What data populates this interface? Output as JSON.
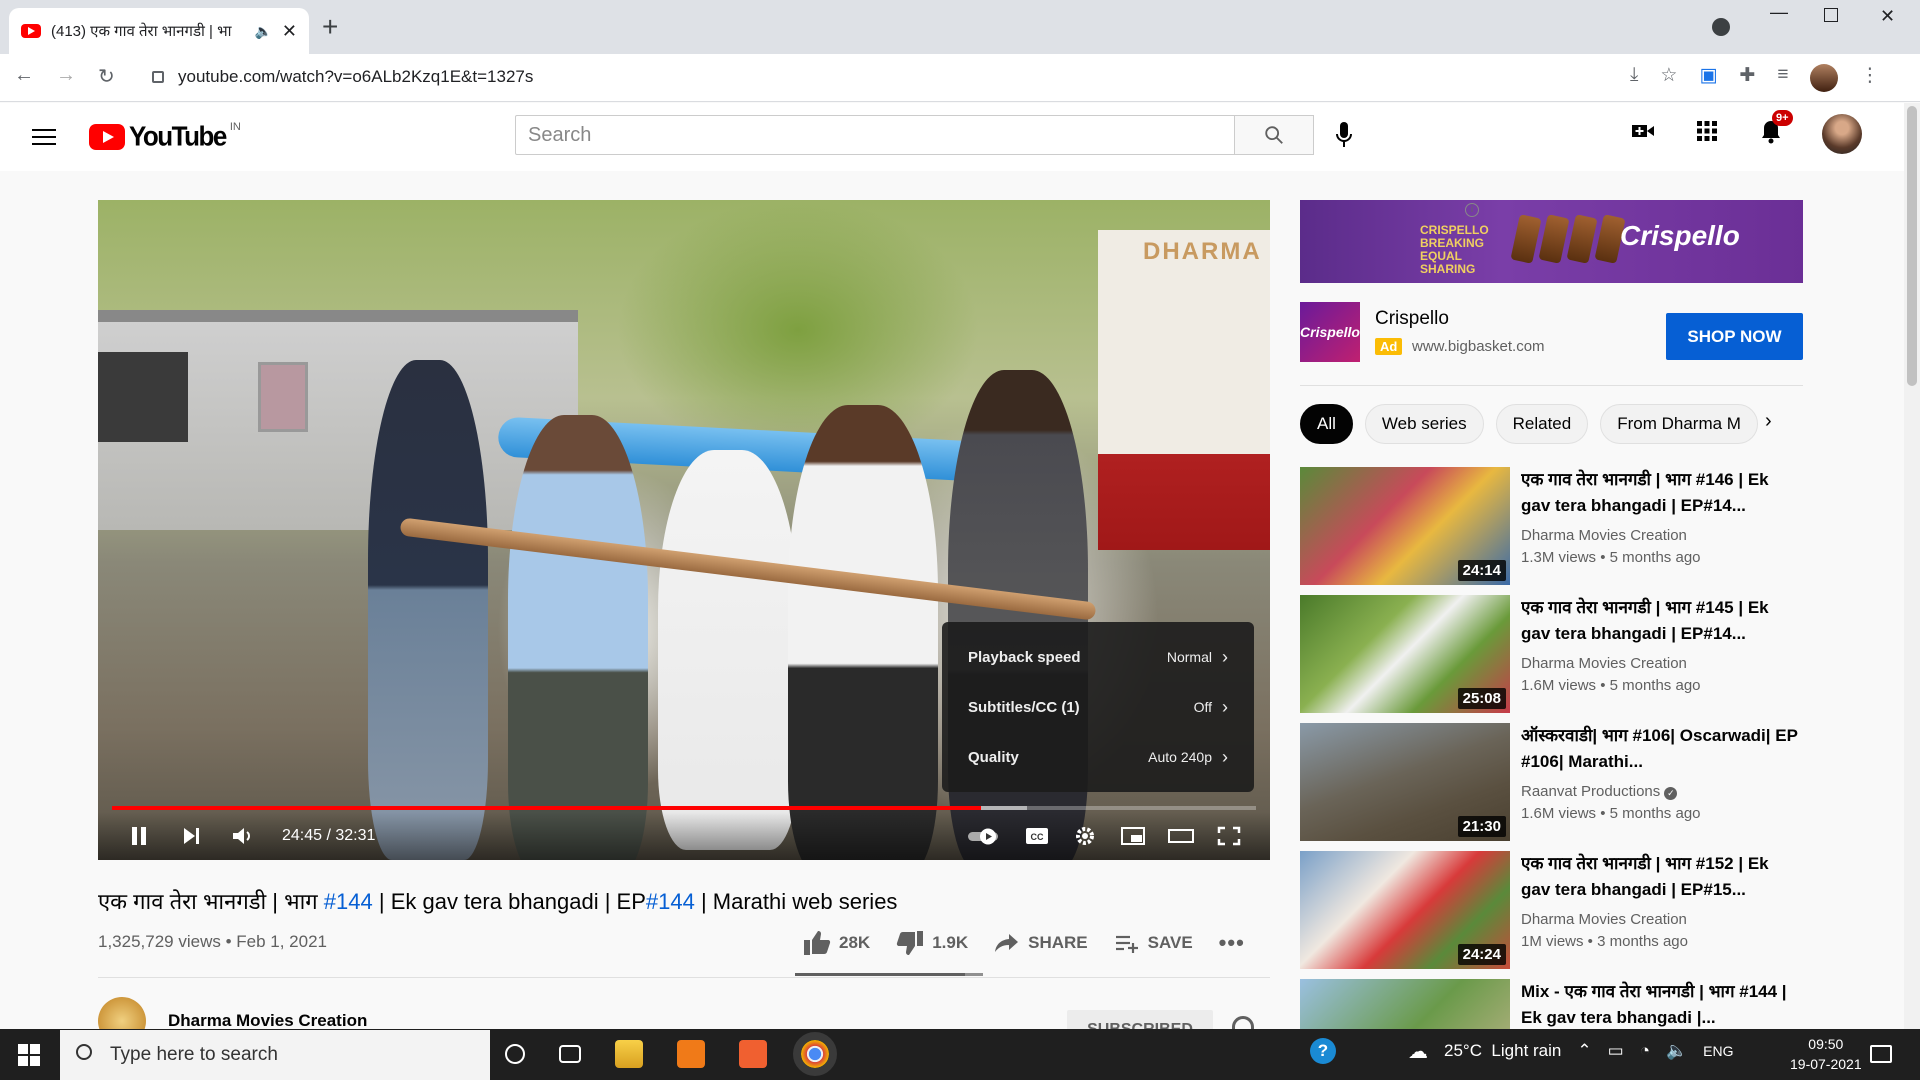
{
  "browser": {
    "tab_title": "(413) एक गाव तेरा भानगडी | भा",
    "url": "youtube.com/watch?v=o6ALb2Kzq1E&t=1327s"
  },
  "header": {
    "logo_text": "YouTube",
    "region": "IN",
    "search_placeholder": "Search",
    "notif_badge": "9+"
  },
  "player": {
    "watermark": "DHARMA",
    "time": "24:45 / 32:31",
    "progress_fraction": 0.76,
    "settings": [
      {
        "label": "Playback speed",
        "value": "Normal"
      },
      {
        "label": "Subtitles/CC (1)",
        "value": "Off"
      },
      {
        "label": "Quality",
        "value": "Auto 240p"
      }
    ]
  },
  "video": {
    "title_a": "एक गाव तेरा भानगडी | भाग ",
    "hash1": "#144",
    "title_b": " | Ek gav tera bhangadi | EP",
    "hash2": "#144",
    "title_c": " | Marathi web series",
    "meta": "1,325,729 views • Feb 1, 2021",
    "likes": "28K",
    "dislikes": "1.9K",
    "share": "SHARE",
    "save": "SAVE",
    "channel": "Dharma Movies Creation",
    "subscribe": "SUBSCRIBED"
  },
  "ad": {
    "banner_text": "CRISPELLO BREAKING EQUAL SHARING",
    "banner_brand": "Crispello",
    "name": "Crispello",
    "badge": "Ad",
    "url": "www.bigbasket.com",
    "cta": "SHOP NOW",
    "logo_text": "Crispello"
  },
  "chips": [
    "All",
    "Web series",
    "Related",
    "From Dharma M"
  ],
  "related": [
    {
      "title": "एक गाव तेरा भानगडी | भाग #146 | Ek gav tera bhangadi | EP#14...",
      "channel": "Dharma Movies Creation",
      "meta": "1.3M views • 5 months ago",
      "duration": "24:14"
    },
    {
      "title": "एक गाव तेरा भानगडी | भाग #145 | Ek gav tera bhangadi | EP#14...",
      "channel": "Dharma Movies Creation",
      "meta": "1.6M views • 5 months ago",
      "duration": "25:08"
    },
    {
      "title": "ऑस्करवाडी| भाग #106| Oscarwadi| EP #106| Marathi...",
      "channel": "Raanvat Productions",
      "meta": "1.6M views • 5 months ago",
      "duration": "21:30"
    },
    {
      "title": "एक गाव तेरा भानगडी | भाग #152 | Ek gav tera bhangadi | EP#15...",
      "channel": "Dharma Movies Creation",
      "meta": "1M views • 3 months ago",
      "duration": "24:24"
    },
    {
      "title": "Mix - एक गाव तेरा भानगडी | भाग #144 | Ek gav tera bhangadi |...",
      "channel": "",
      "meta": "",
      "duration": ""
    }
  ],
  "taskbar": {
    "search_placeholder": "Type here to search",
    "weather": "25°C  Light rain",
    "lang": "ENG",
    "time": "09:50",
    "date": "19-07-2021"
  }
}
